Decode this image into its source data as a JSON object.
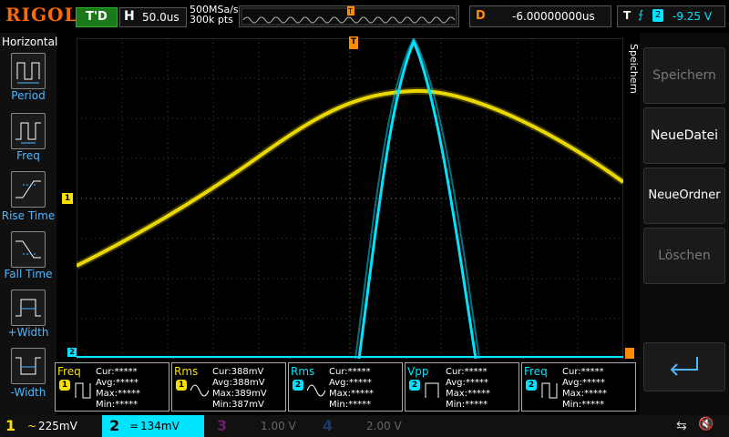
{
  "brand": "RIGOL",
  "run_state": "T'D",
  "horizontal": {
    "label": "H",
    "timebase": "50.0us"
  },
  "acquisition": {
    "sample_rate": "500MSa/s",
    "points": "300k pts"
  },
  "trigger_marker": "T",
  "delay": {
    "label": "D",
    "value": "-6.00000000us"
  },
  "trigger": {
    "label": "T",
    "source": "2",
    "level": "-9.25 V"
  },
  "left_panel": {
    "title": "Horizontal",
    "items": [
      {
        "label": "Period",
        "icon": "period-icon"
      },
      {
        "label": "Freq",
        "icon": "freq-icon"
      },
      {
        "label": "Rise Time",
        "icon": "rise-time-icon"
      },
      {
        "label": "Fall Time",
        "icon": "fall-time-icon"
      },
      {
        "label": "+Width",
        "icon": "pos-width-icon"
      },
      {
        "label": "-Width",
        "icon": "neg-width-icon"
      }
    ]
  },
  "right_panel": {
    "title": "Speichern",
    "buttons": [
      "Speichern",
      "NeueDatei",
      "NeueOrdner",
      "Löschen"
    ]
  },
  "measurements": [
    {
      "name": "Freq",
      "channel": "1",
      "cur": "Cur:*****",
      "avg": "Avg:*****",
      "max": "Max:*****",
      "min": "Min:*****"
    },
    {
      "name": "Rms",
      "channel": "1",
      "cur": "Cur:388mV",
      "avg": "Avg:388mV",
      "max": "Max:389mV",
      "min": "Min:387mV"
    },
    {
      "name": "Rms",
      "channel": "2",
      "cur": "Cur:*****",
      "avg": "Avg:*****",
      "max": "Max:*****",
      "min": "Min:*****"
    },
    {
      "name": "Vpp",
      "channel": "2",
      "cur": "Cur:*****",
      "avg": "Avg:*****",
      "max": "Max:*****",
      "min": "Min:*****"
    },
    {
      "name": "Freq",
      "channel": "2",
      "cur": "Cur:*****",
      "avg": "Avg:*****",
      "max": "Max:*****",
      "min": "Min:*****"
    }
  ],
  "channels": [
    {
      "num": "1",
      "scale": "225mV",
      "coupling": "~",
      "color": "#f5e000",
      "active": true
    },
    {
      "num": "2",
      "scale": "134mV",
      "coupling": "=",
      "color": "#00e5ff",
      "active": true
    },
    {
      "num": "3",
      "scale": "1.00 V",
      "coupling": "",
      "color": "#6a1f6a",
      "active": false
    },
    {
      "num": "4",
      "scale": "2.00 V",
      "coupling": "",
      "color": "#1f3a6a",
      "active": false
    }
  ],
  "colors": {
    "ch1": "#f5e000",
    "ch2": "#00e5ff",
    "accent": "#ff8c00",
    "grid": "#555555"
  }
}
